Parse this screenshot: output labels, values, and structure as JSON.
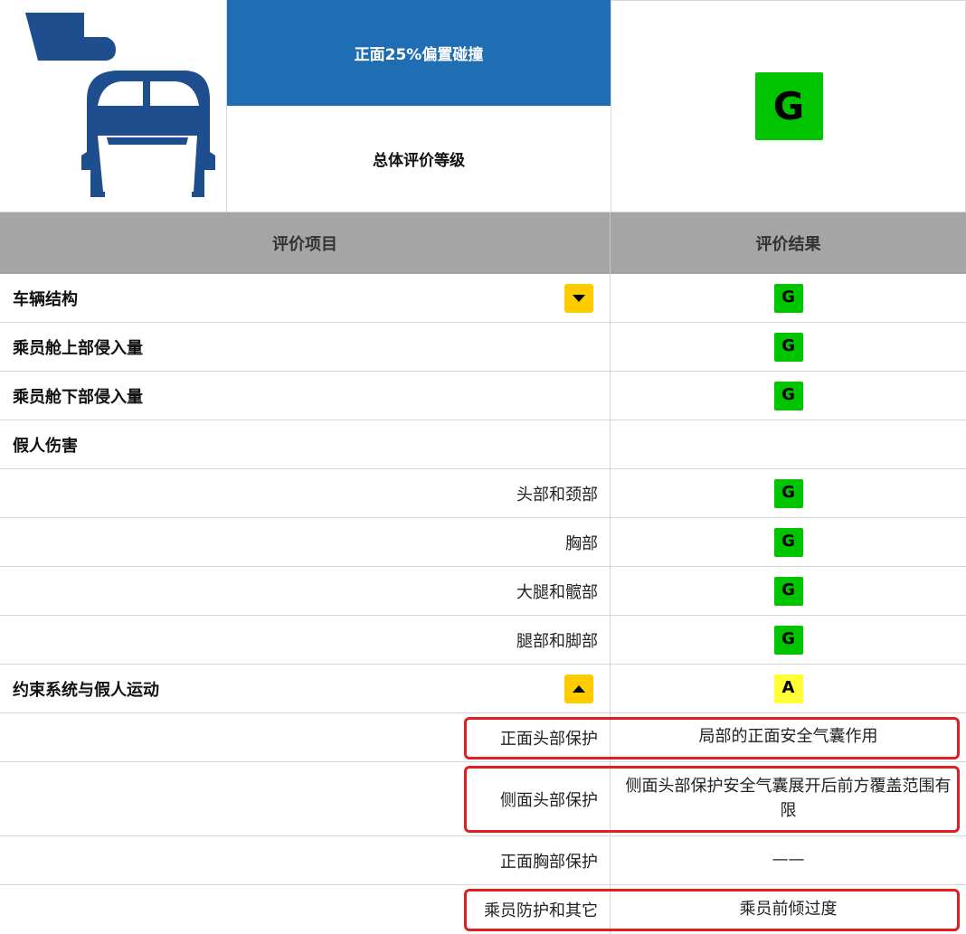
{
  "header": {
    "test_name": "正面25%偏置碰撞",
    "overall_label": "总体评价等级",
    "overall_rating": "G",
    "icon": "frontal-offset-crash-icon"
  },
  "columns": {
    "item": "评价项目",
    "result": "评价结果"
  },
  "rows": [
    {
      "label": "车辆结构",
      "rating": "G"
    },
    {
      "label": "乘员舱上部侵入量",
      "rating": "G"
    },
    {
      "label": "乘员舱下部侵入量",
      "rating": "G"
    },
    {
      "label": "假人伤害",
      "rating": ""
    },
    {
      "label": "头部和颈部",
      "rating": "G"
    },
    {
      "label": "胸部",
      "rating": "G"
    },
    {
      "label": "大腿和髋部",
      "rating": "G"
    },
    {
      "label": "腿部和脚部",
      "rating": "G"
    },
    {
      "label": "约束系统与假人运动",
      "rating": "A"
    },
    {
      "label": "正面头部保护",
      "result": "局部的正面安全气囊作用"
    },
    {
      "label": "侧面头部保护",
      "result": "侧面头部保护安全气囊展开后前方覆盖范围有限"
    },
    {
      "label": "正面胸部保护",
      "result": "——"
    },
    {
      "label": "乘员防护和其它",
      "result": "乘员前倾过度"
    }
  ],
  "colors": {
    "header_blue": "#1f6db3",
    "good_green": "#00c400",
    "acceptable_yellow": "#ffff33",
    "toggle_amber": "#ffcc00",
    "highlight_red": "#e02020",
    "column_header_gray": "#a5a5a5"
  }
}
